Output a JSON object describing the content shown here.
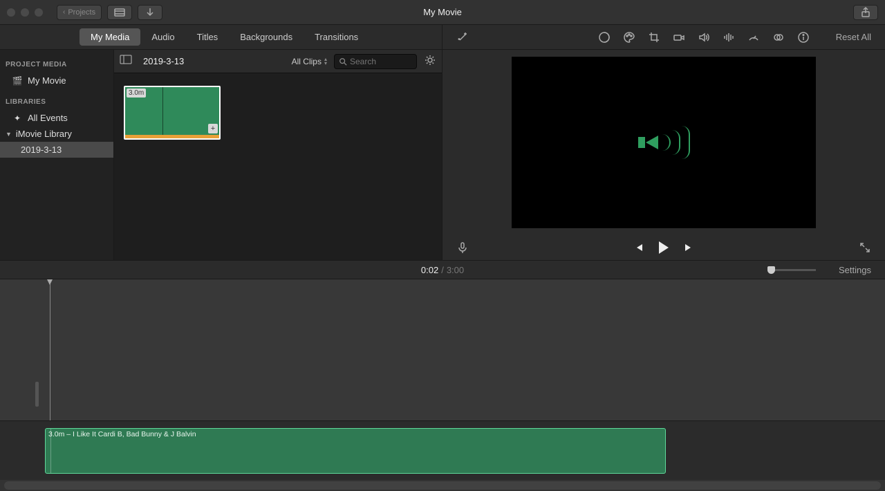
{
  "titlebar": {
    "projects_label": "Projects",
    "movie_title": "My Movie"
  },
  "tabs": {
    "my_media": "My Media",
    "audio": "Audio",
    "titles": "Titles",
    "backgrounds": "Backgrounds",
    "transitions": "Transitions"
  },
  "sidebar": {
    "heading_project_media": "PROJECT MEDIA",
    "my_movie": "My Movie",
    "heading_libraries": "LIBRARIES",
    "all_events": "All Events",
    "imovie_library": "iMovie Library",
    "event_date": "2019-3-13"
  },
  "browser": {
    "event_name": "2019-3-13",
    "clips_filter": "All Clips",
    "search_placeholder": "Search",
    "clip_duration": "3.0m"
  },
  "toolbar": {
    "reset_all": "Reset All"
  },
  "timecode": {
    "current": "0:02",
    "separator": "/",
    "total": "3:00",
    "settings": "Settings"
  },
  "timeline": {
    "audio_clip_label": "3.0m – I Like It Cardi B, Bad Bunny & J Balvin"
  }
}
